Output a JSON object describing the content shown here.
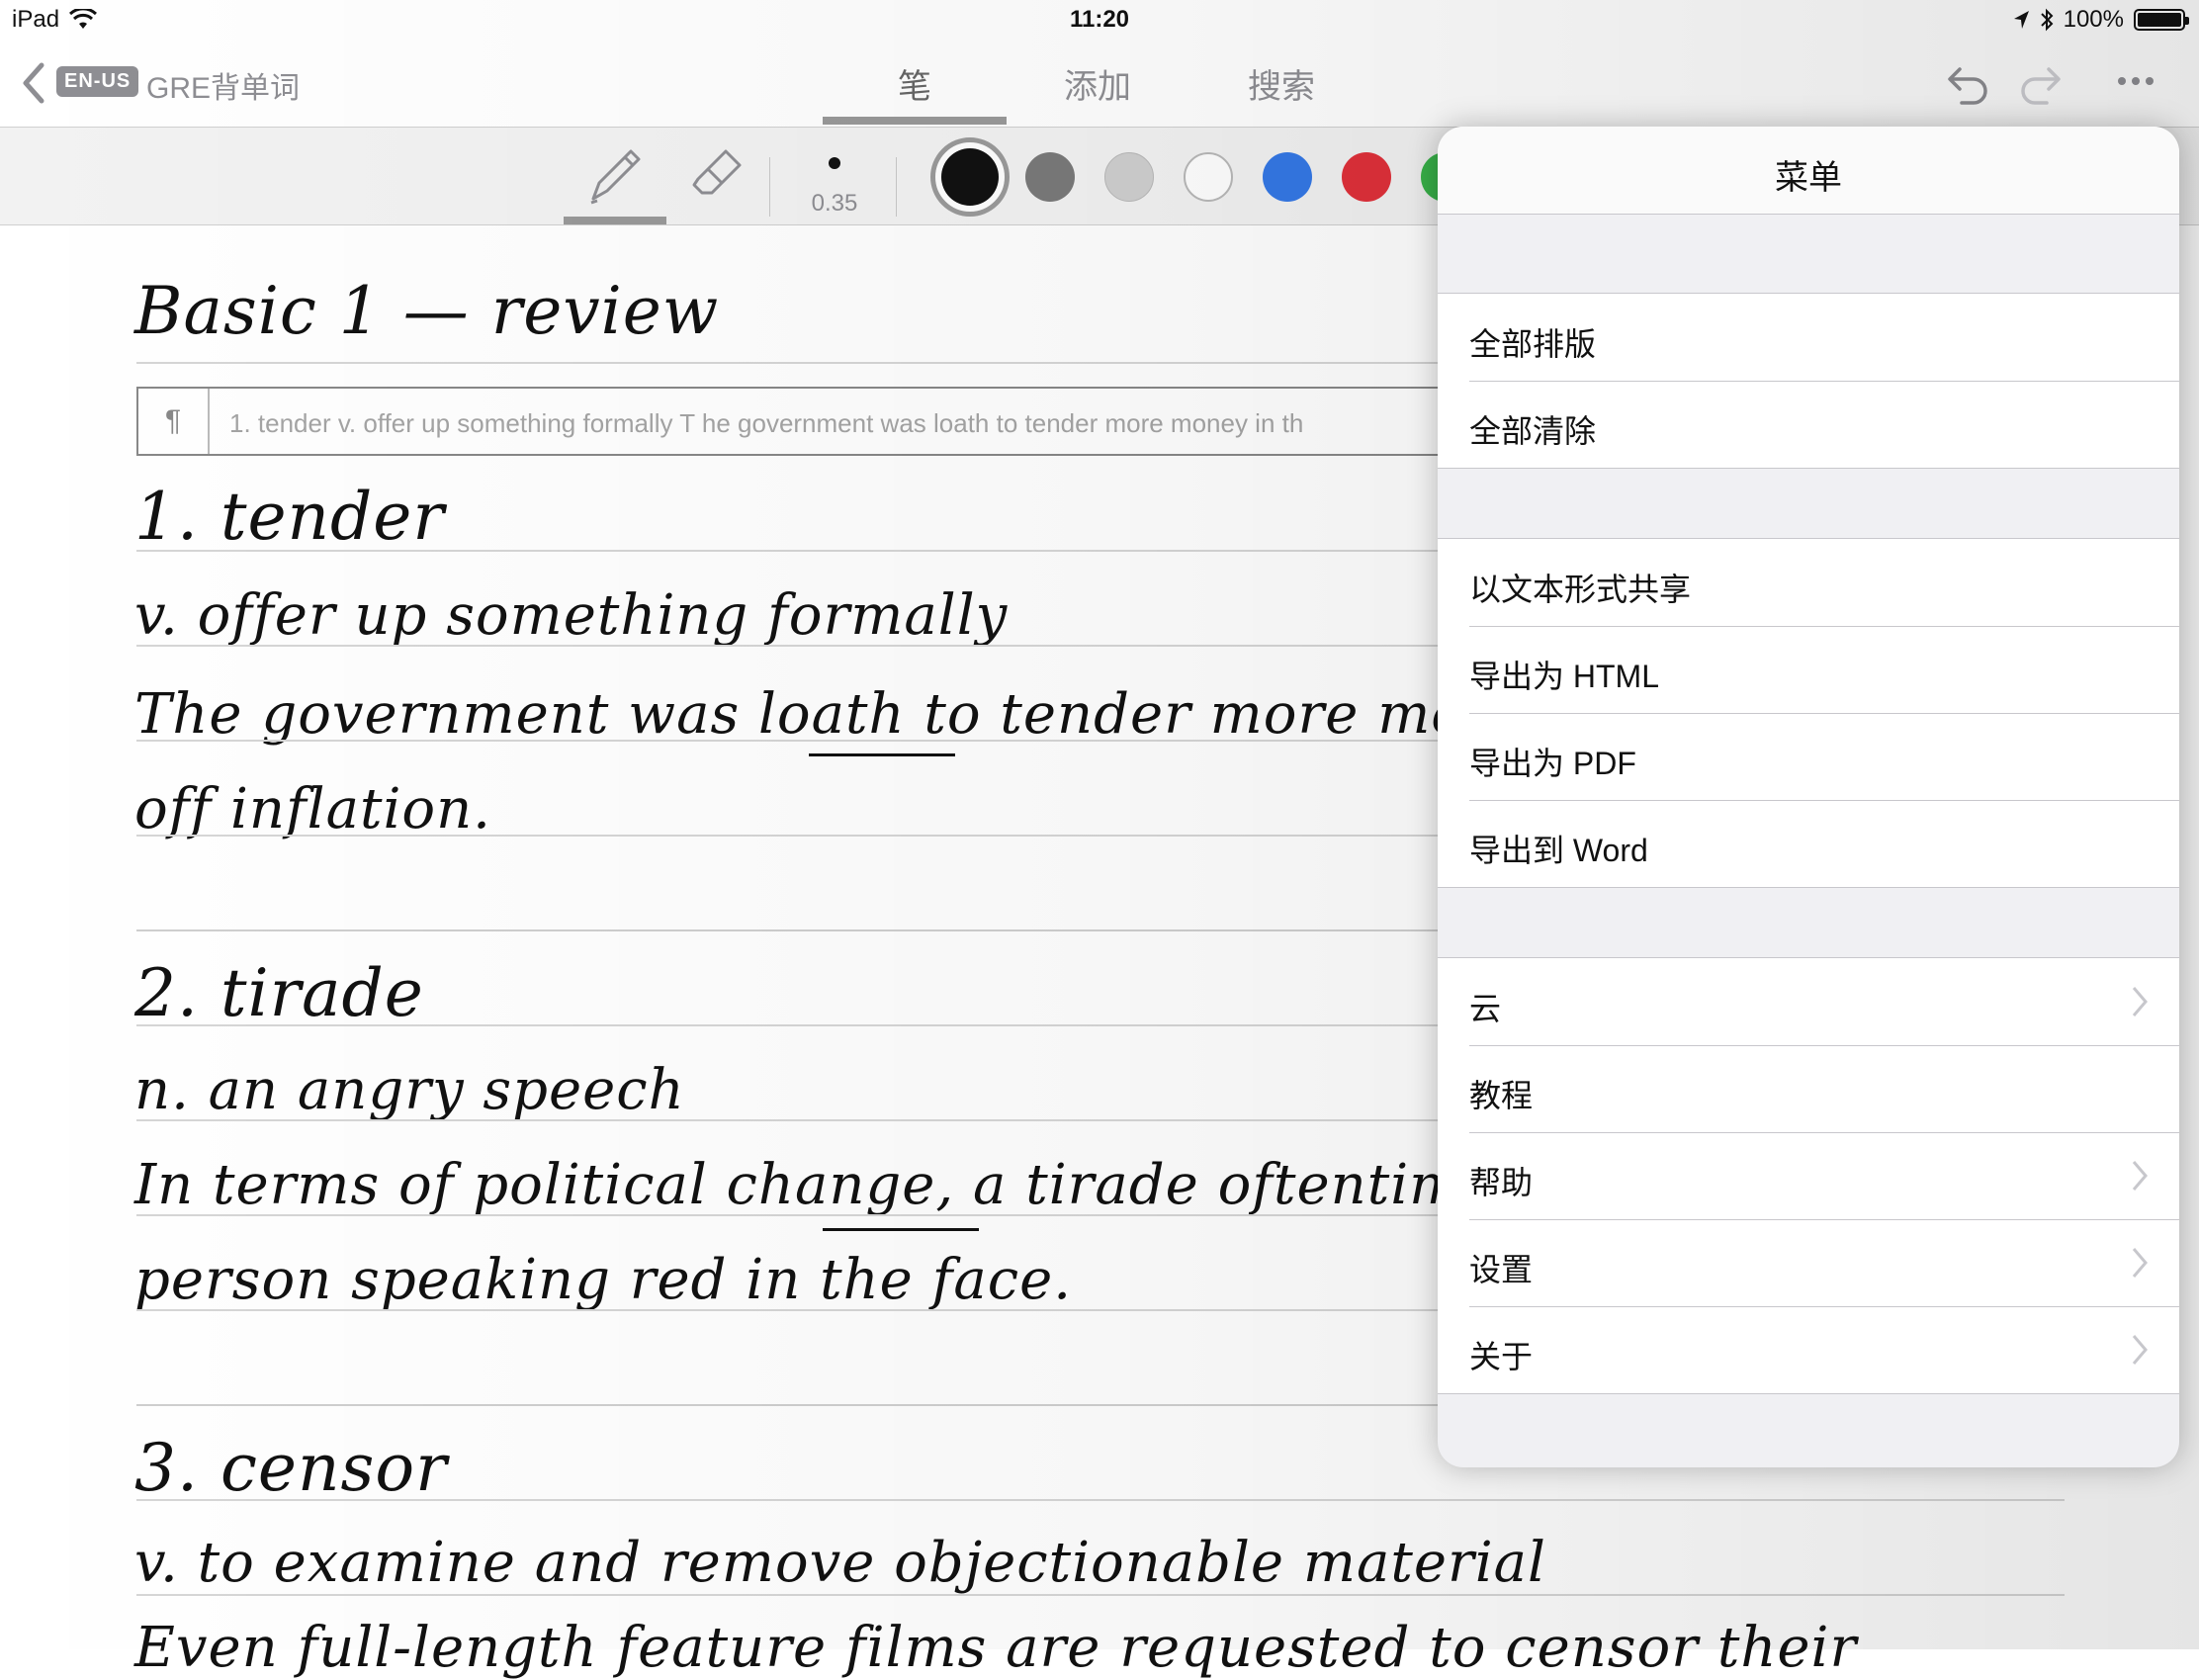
{
  "status_bar": {
    "device": "iPad",
    "time": "11:20",
    "battery": "100%",
    "battery_level": 1.0
  },
  "nav": {
    "lang_badge": "EN-US",
    "doc_title": "GRE背单词",
    "tabs": [
      {
        "label": "笔",
        "active": true
      },
      {
        "label": "添加",
        "active": false
      },
      {
        "label": "搜索",
        "active": false
      }
    ]
  },
  "toolbar": {
    "pen_size": "0.35",
    "colors": [
      "#111111",
      "#7a7a7a",
      "#cfcfcf",
      "#ffffff",
      "#3478e6",
      "#e0303a",
      "#39b54a"
    ],
    "selected_color": "#111111"
  },
  "note": {
    "heading": "Basic 1 — review",
    "recognized_text": "1. tender v. offer up something formally T he government was loath to tender more money in th",
    "lines": {
      "l1": "1.   tender",
      "l2": "v.   offer up something formally",
      "l3": "The government was loath to tender more money in the",
      "l4": "off inflation.",
      "l5": "2.   tirade",
      "l6": "n.   an angry speech",
      "l7": "In terms of political change, a tirade oftentimes does l",
      "l8": "person speaking red in the face.",
      "l9": "3.   censor",
      "l10": "v.   to examine and remove objectionable material",
      "l11": "Even full-length feature films are requested to censor their"
    }
  },
  "menu": {
    "title": "菜单",
    "group1": [
      {
        "label": "全部排版",
        "chevron": false
      },
      {
        "label": "全部清除",
        "chevron": false
      }
    ],
    "group2": [
      {
        "label": "以文本形式共享",
        "chevron": false
      },
      {
        "label": "导出为 HTML",
        "chevron": false
      },
      {
        "label": "导出为 PDF",
        "chevron": false
      },
      {
        "label": "导出到 Word",
        "chevron": false
      }
    ],
    "group3": [
      {
        "label": "云",
        "chevron": true
      },
      {
        "label": "教程",
        "chevron": false
      },
      {
        "label": "帮助",
        "chevron": true
      },
      {
        "label": "设置",
        "chevron": true
      },
      {
        "label": "关于",
        "chevron": true
      }
    ]
  }
}
